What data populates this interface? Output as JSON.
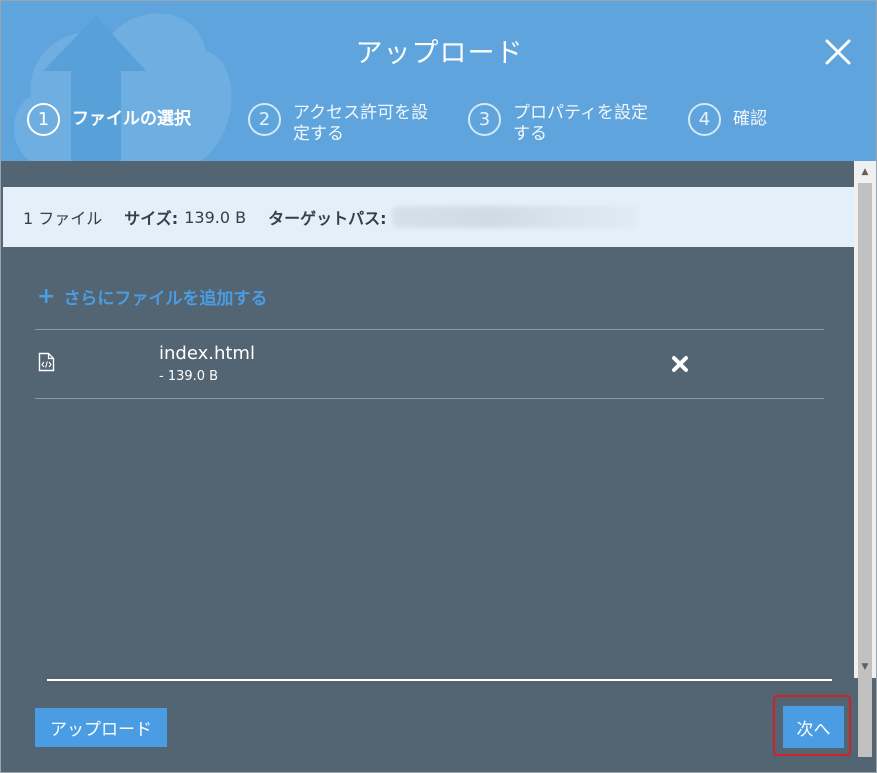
{
  "dialog": {
    "title": "アップロード"
  },
  "steps": [
    {
      "number": "1",
      "label": "ファイルの選択",
      "active": true
    },
    {
      "number": "2",
      "label": "アクセス許可を設定する",
      "active": false
    },
    {
      "number": "3",
      "label": "プロパティを設定する",
      "active": false
    },
    {
      "number": "4",
      "label": "確認",
      "active": false
    }
  ],
  "summary": {
    "file_count": "1 ファイル",
    "size_label": "サイズ:",
    "size_value": "139.0 B",
    "target_path_label": "ターゲットパス:"
  },
  "add_more": {
    "label": "さらにファイルを追加する"
  },
  "files": [
    {
      "name": "index.html",
      "size": "- 139.0 B"
    }
  ],
  "footer": {
    "upload_label": "アップロード",
    "next_label": "次へ"
  },
  "colors": {
    "header": "#5fa4dc",
    "body": "#536473",
    "accent": "#4a9de3",
    "highlight": "#d21f2a"
  },
  "icons": {
    "close": "close-icon",
    "file": "code-file-icon",
    "remove": "remove-icon",
    "add": "plus-icon"
  }
}
